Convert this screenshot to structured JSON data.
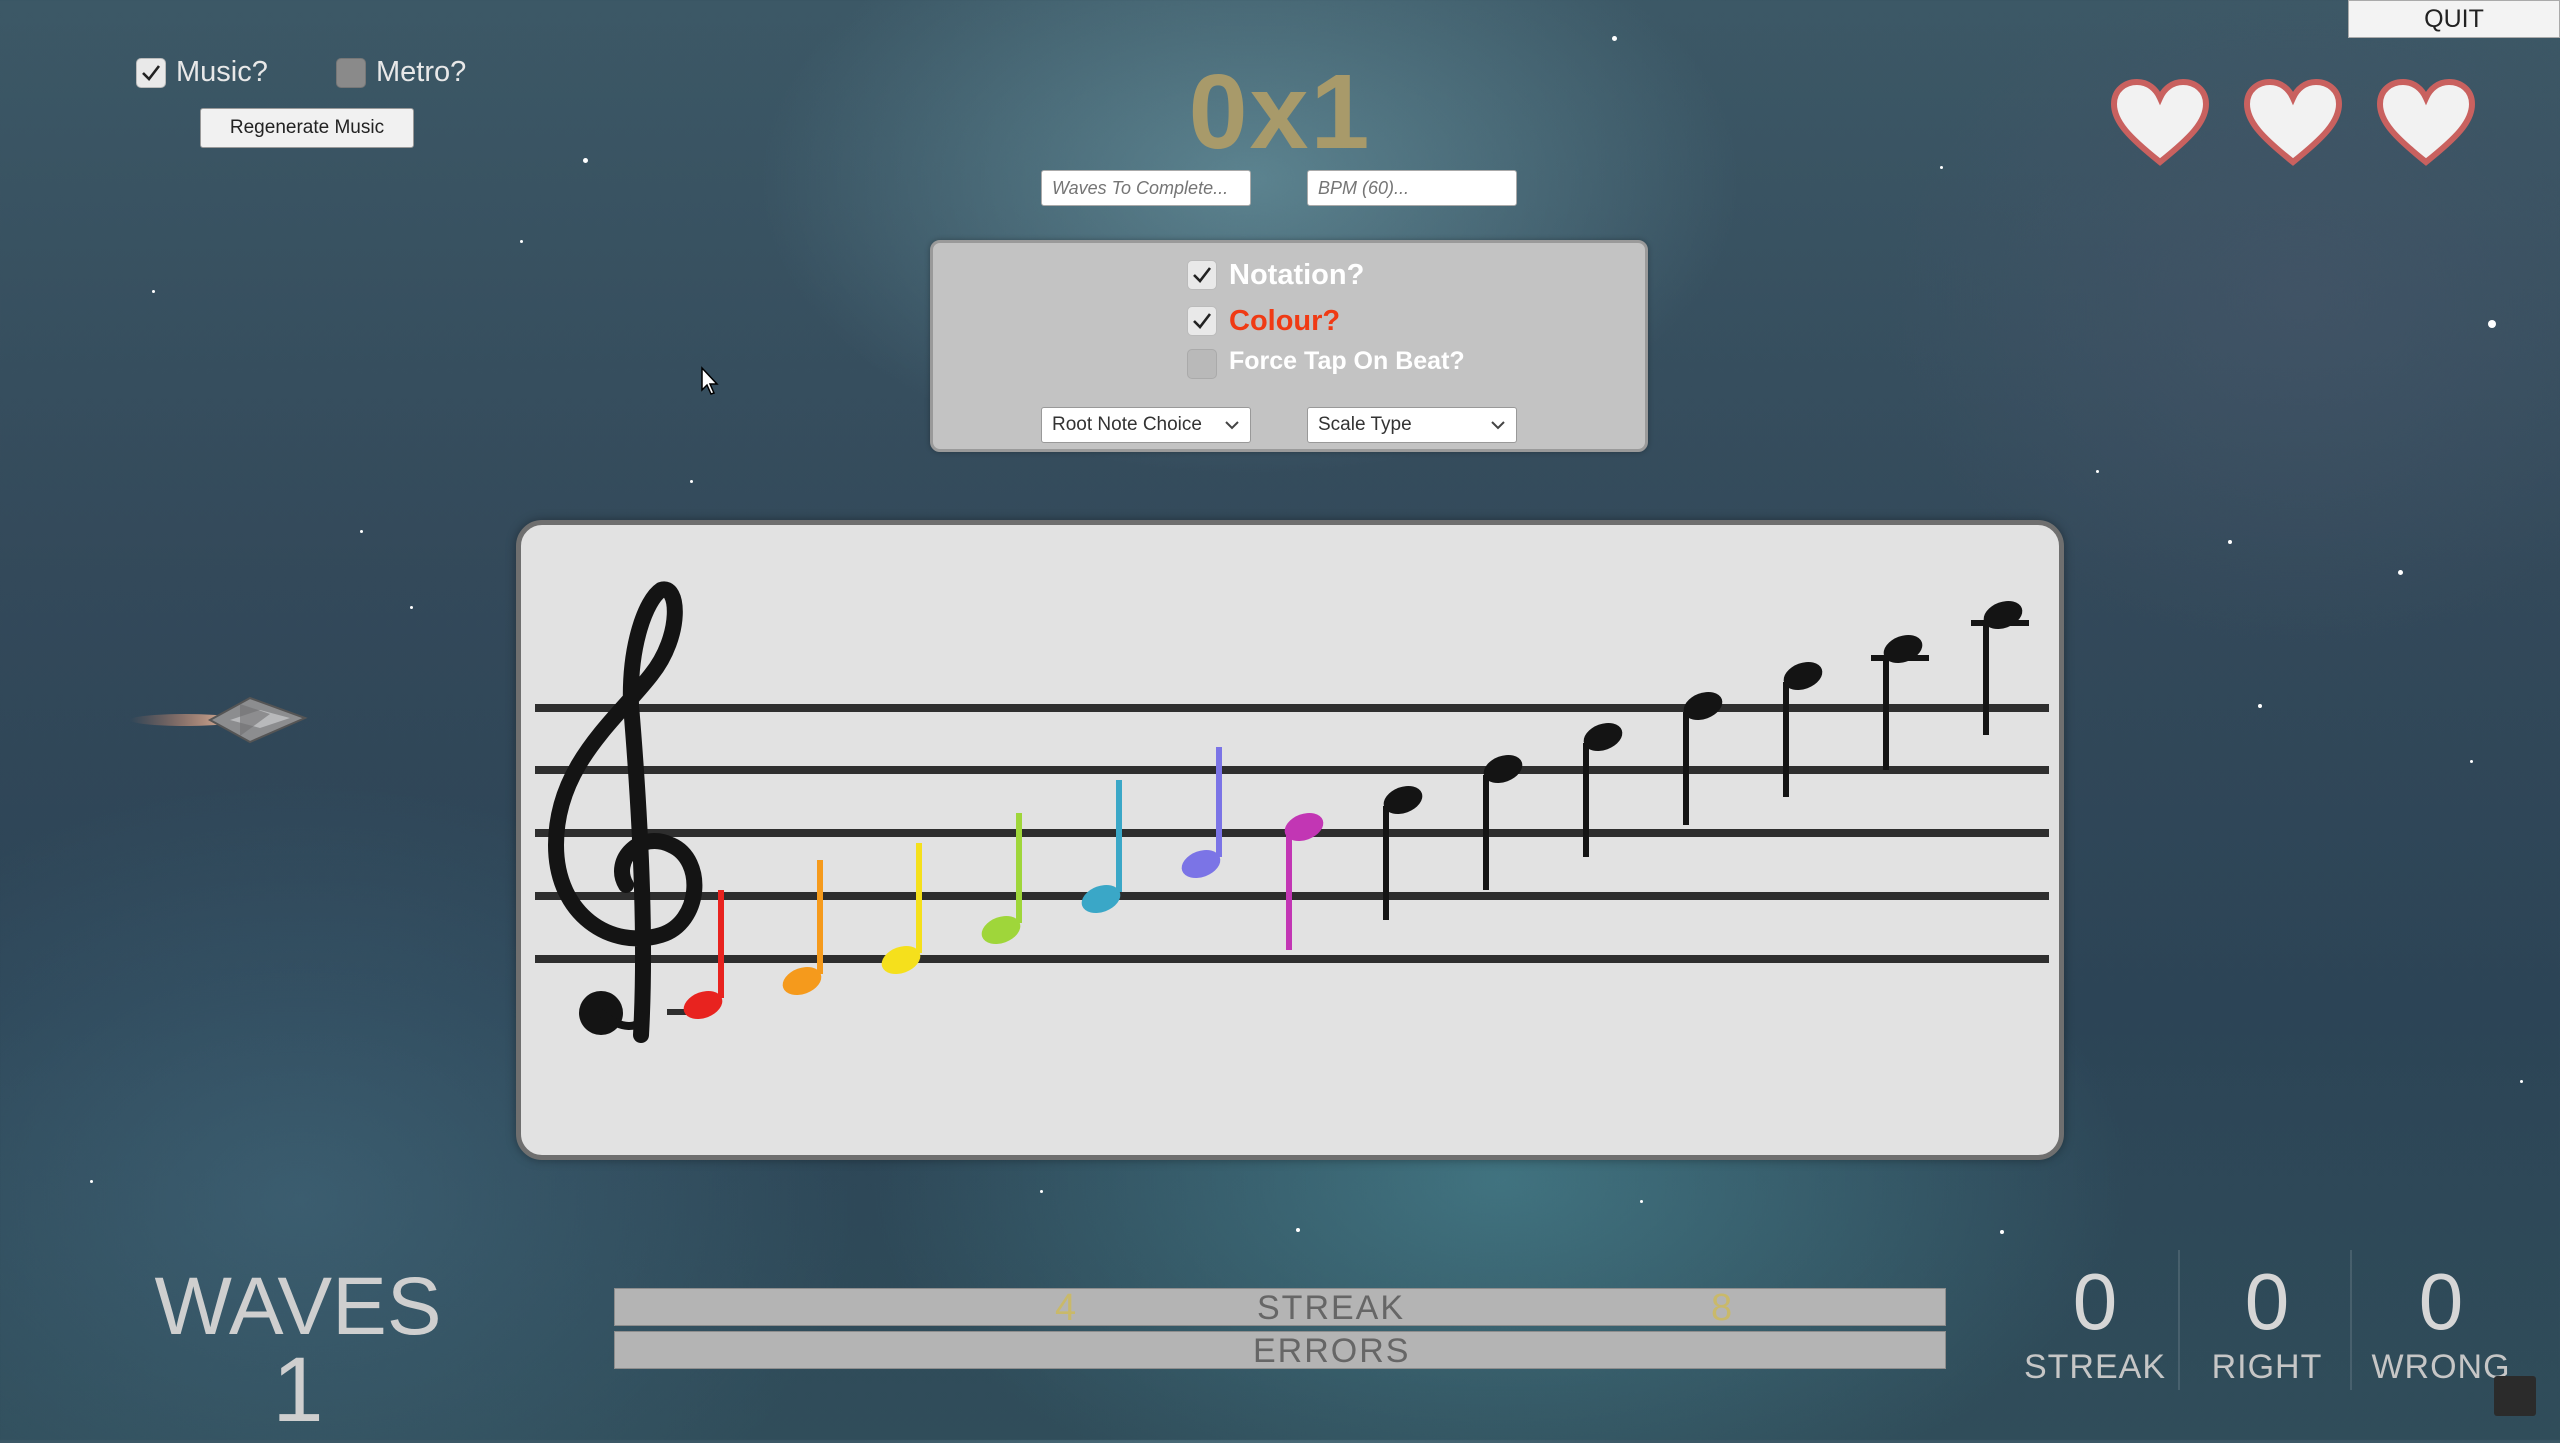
{
  "top_left": {
    "music_label": "Music?",
    "music_checked": true,
    "metro_label": "Metro?",
    "metro_checked": false,
    "regenerate_label": "Regenerate Music"
  },
  "score": {
    "multiplier": "0x1"
  },
  "inputs": {
    "waves_placeholder": "Waves To Complete...",
    "bpm_placeholder": "BPM (60)..."
  },
  "quit_label": "QUIT",
  "lives": 3,
  "options": {
    "notation_label": "Notation?",
    "notation_checked": true,
    "colour_label": "Colour?",
    "colour_checked": true,
    "force_tap_label": "Force Tap On Beat?",
    "force_tap_checked": false,
    "root_note_label": "Root Note Choice",
    "scale_type_label": "Scale Type"
  },
  "staff": {
    "clef": "treble",
    "note_colors": [
      "#e8231f",
      "#f59a1c",
      "#f5e01c",
      "#9fd63a",
      "#3aa7c7",
      "#7b74e6",
      "#c236b4"
    ]
  },
  "bottom": {
    "waves_label": "WAVES",
    "waves_value": "1",
    "bar_left_value": "4",
    "bar_streak_label": "STREAK",
    "bar_right_value": "8",
    "bar_errors_label": "ERRORS",
    "streak_value": "0",
    "streak_label": "STREAK",
    "right_value": "0",
    "right_label": "RIGHT",
    "wrong_value": "0",
    "wrong_label": "WRONG"
  }
}
